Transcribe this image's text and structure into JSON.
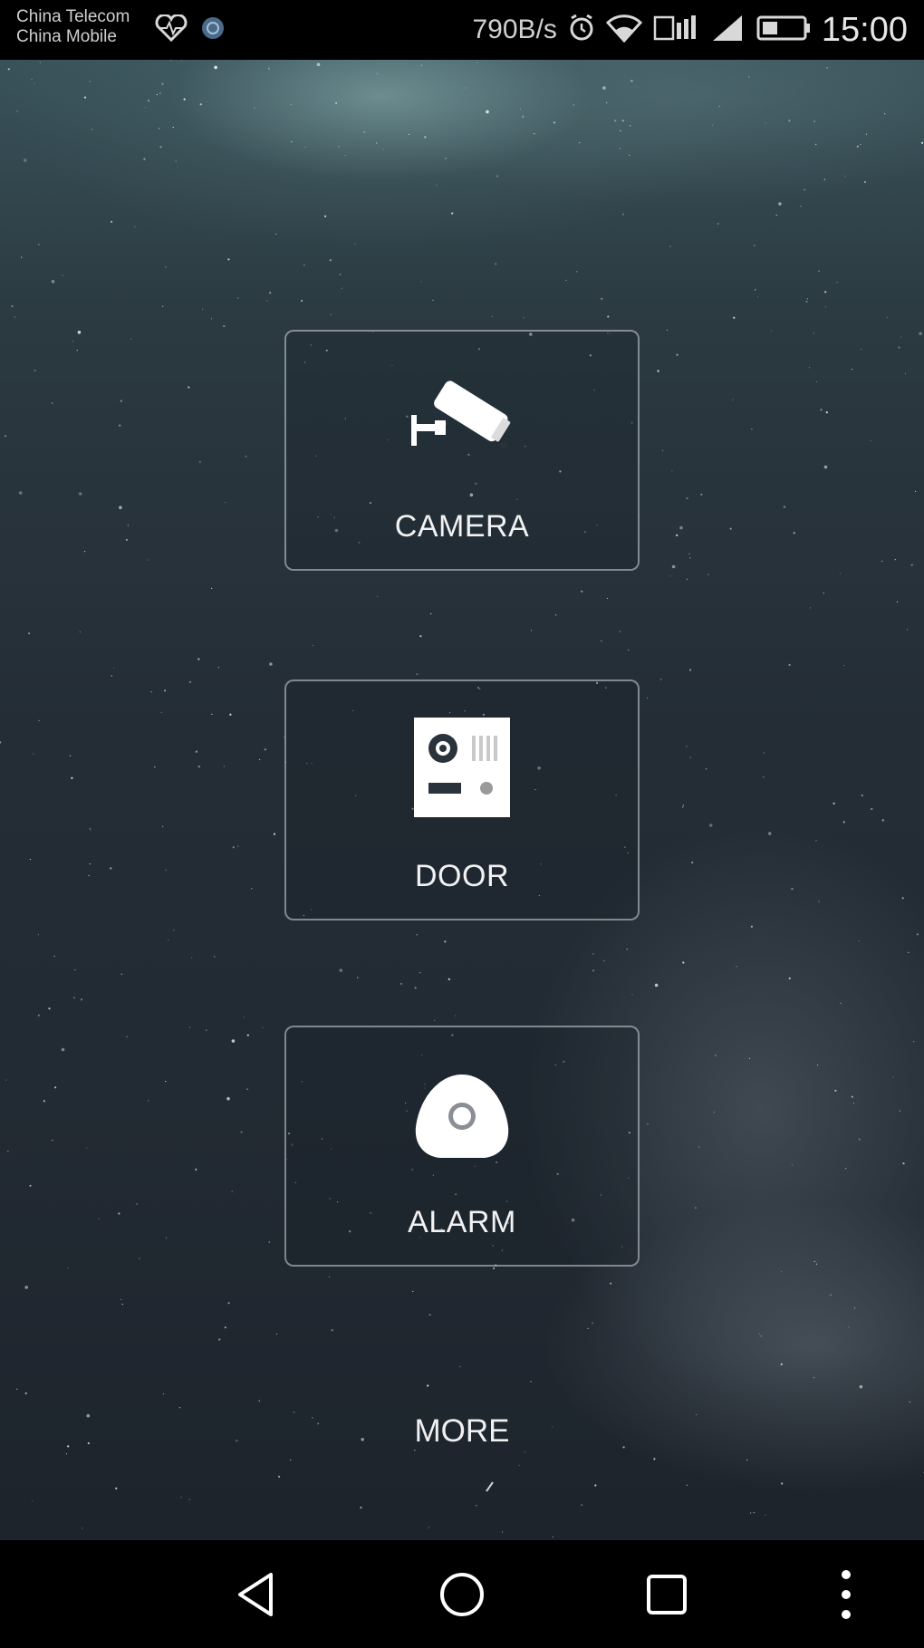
{
  "status_bar": {
    "carrier_1": "China Telecom",
    "carrier_2": "China Mobile",
    "net_speed": "790B/s",
    "time": "15:00",
    "icons": [
      "heart-rate-icon",
      "notification-icon",
      "alarm-clock-icon",
      "wifi-icon",
      "hd-signal-icon",
      "signal-icon",
      "battery-icon"
    ]
  },
  "tiles": {
    "camera": {
      "label": "CAMERA",
      "icon": "cctv-camera-icon"
    },
    "door": {
      "label": "DOOR",
      "icon": "door-intercom-icon"
    },
    "alarm": {
      "label": "ALARM",
      "icon": "alarm-sensor-icon"
    }
  },
  "more": {
    "label": "MORE"
  },
  "nav_bar": {
    "icons": [
      "back-icon",
      "home-icon",
      "recents-icon",
      "more-vert-icon"
    ]
  },
  "colors": {
    "tile_border": "#d2d7dc",
    "text": "#f2f2f2",
    "background_top": "#39525a",
    "background_bottom": "#1d242c"
  }
}
